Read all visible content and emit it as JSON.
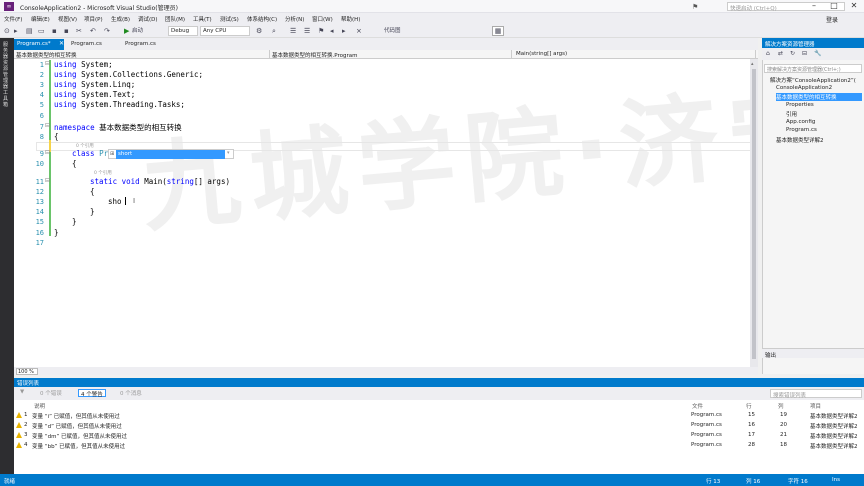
{
  "window": {
    "title": "ConsoleApplication2 - Microsoft Visual Studio(管理员)",
    "quick_launch_placeholder": "快速启动 (Ctrl+Q)",
    "login": "登录"
  },
  "menu": [
    "文件(F)",
    "编辑(E)",
    "视图(V)",
    "项目(P)",
    "生成(B)",
    "调试(D)",
    "团队(M)",
    "工具(T)",
    "测试(S)",
    "体系结构(C)",
    "分析(N)",
    "窗口(W)",
    "帮助(H)"
  ],
  "toolbar": {
    "start_label": "启动",
    "config": "Debug",
    "platform": "Any CPU",
    "code_map": "代码图"
  },
  "left_strip": "服务器资源管理器 工具箱",
  "tabs": [
    {
      "label": "Program.cs*",
      "active": true
    },
    {
      "label": "Program.cs",
      "active": false
    },
    {
      "label": "Program.cs",
      "active": false
    }
  ],
  "nav": {
    "project": "基本数据类型的相互转换",
    "class": "基本数据类型的相互转换.Program",
    "member": "Main(string[] args)"
  },
  "watermark": "九城学院·济宁分校",
  "code": {
    "line_numbers": [
      "1",
      "2",
      "3",
      "4",
      "5",
      "6",
      "7",
      "8",
      "9",
      "10",
      "11",
      "12",
      "13",
      "14",
      "15",
      "16",
      "17"
    ],
    "using1": "System;",
    "using2": "System.Collections.Generic;",
    "using3": "System.Linq;",
    "using4": "System.Text;",
    "using5": "System.Threading.Tasks;",
    "kw_using": "using",
    "kw_namespace": "namespace",
    "namespace_name": "基本数据类型的相互转换",
    "brace_open": "{",
    "brace_close": "}",
    "ref_class": "0 个引用",
    "kw_class": "class",
    "class_name": "Program",
    "ref_method": "0 个引用",
    "kw_static": "static",
    "kw_void": "void",
    "method_sig_a": "Main(",
    "kw_string": "string",
    "method_sig_b": "[] args)",
    "typed": "sho",
    "intellisense": "short"
  },
  "zoom": "100 %",
  "error_list": {
    "title": "错误列表",
    "errors_btn": "0 个错误",
    "warnings_btn": "4 个警告",
    "messages_btn": "0 个消息",
    "search_placeholder": "搜索错误列表",
    "columns": [
      "说明",
      "文件",
      "行",
      "列",
      "项目"
    ],
    "rows": [
      {
        "num": "1",
        "desc": "变量 “i” 已赋值，但其值从未使用过",
        "file": "Program.cs",
        "line": "15",
        "col": "19",
        "project": "基本数据类型详解2"
      },
      {
        "num": "2",
        "desc": "变量 “d” 已赋值，但其值从未使用过",
        "file": "Program.cs",
        "line": "16",
        "col": "20",
        "project": "基本数据类型详解2"
      },
      {
        "num": "3",
        "desc": "变量 “dm” 已赋值，但其值从未使用过",
        "file": "Program.cs",
        "line": "17",
        "col": "21",
        "project": "基本数据类型详解2"
      },
      {
        "num": "4",
        "desc": "变量 “bb” 已赋值，但其值从未使用过",
        "file": "Program.cs",
        "line": "28",
        "col": "18",
        "project": "基本数据类型详解2"
      }
    ]
  },
  "solution_explorer": {
    "title": "解决方案资源管理器",
    "search_placeholder": "搜索解决方案资源管理器(Ctrl+;)",
    "items": [
      "解决方案“ConsoleApplication2”(",
      "ConsoleApplication2",
      "基本数据类型的相互转换",
      "Properties",
      "引用",
      "App.config",
      "Program.cs",
      "基本数据类型详解2"
    ]
  },
  "output_panel": "输出",
  "status": {
    "ready": "就绪",
    "line": "行 13",
    "col": "列 16",
    "char": "字符 16",
    "mode": "Ins"
  }
}
